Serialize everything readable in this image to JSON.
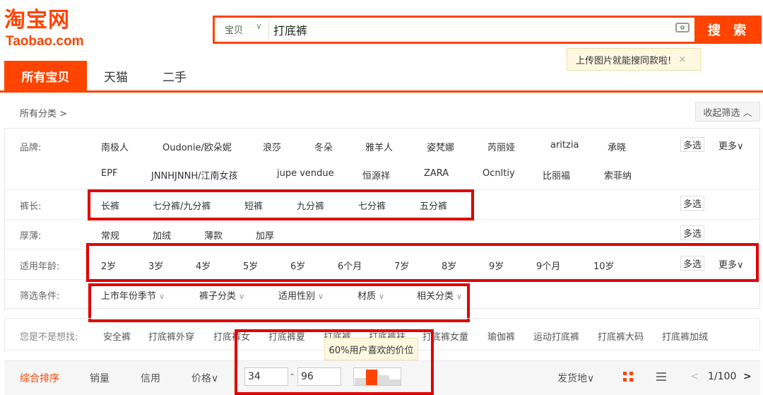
{
  "logo": {
    "cn": "淘宝网",
    "en": "Taobao.com"
  },
  "search": {
    "category": "宝贝",
    "query": "打底裤",
    "button": "搜 索",
    "tooltip": "上传图片就能搜同款啦!",
    "tooltip_close": "×"
  },
  "tabs": [
    "所有宝贝",
    "天猫",
    "二手"
  ],
  "category_bar": {
    "label": "所有分类 >",
    "collapse": "收起筛选 ︿"
  },
  "filters": {
    "brand": {
      "label": "品牌:",
      "row1": [
        "南极人",
        "Oudonie/欧朵妮",
        "浪莎",
        "冬朵",
        "雅羊人",
        "姿梵娜",
        "芮丽娅",
        "aritzia",
        "承晓"
      ],
      "row2": [
        "EPF",
        "JNNHJNNH/江南女孩",
        "jupe vendue",
        "恒源祥",
        "ZARA",
        "Ocnltiy",
        "比丽福",
        "索菲纳"
      ],
      "multi": "多选",
      "more": "更多∨"
    },
    "length": {
      "label": "裤长:",
      "options": [
        "长裤",
        "七分裤/九分裤",
        "短裤",
        "九分裤",
        "七分裤",
        "五分裤"
      ],
      "multi": "多选"
    },
    "thickness": {
      "label": "厚薄:",
      "options": [
        "常规",
        "加绒",
        "薄款",
        "加厚"
      ],
      "multi": "多选"
    },
    "age": {
      "label": "适用年龄:",
      "options": [
        "2岁",
        "3岁",
        "4岁",
        "5岁",
        "6岁",
        "6个月",
        "7岁",
        "8岁",
        "9岁",
        "9个月",
        "10岁"
      ],
      "multi": "多选",
      "more": "更多∨"
    },
    "conditions": {
      "label": "筛选条件:",
      "options": [
        "上市年份季节",
        "裤子分类",
        "适用性别",
        "材质",
        "相关分类"
      ],
      "chevron": "∨"
    }
  },
  "suggestions": {
    "label": "您是不是想找:",
    "items": [
      "安全裤",
      "打底裤外穿",
      "打底裤女",
      "打底裤夏",
      "打底裤",
      "打底裤袜",
      "打底裤女童",
      "瑜伽裤",
      "运动打底裤",
      "打底裤大码",
      "打底裤加绒"
    ]
  },
  "sort": {
    "items": [
      "综合排序",
      "销量",
      "信用",
      "价格∨"
    ],
    "price_min": "34",
    "price_max": "96",
    "price_sep": "-",
    "price_tip": "60%用户喜欢的价位",
    "ship_from": "发货地∨",
    "page": "1/100",
    "prev": "<",
    "next": ">"
  },
  "colors": {
    "accent": "#ff4400",
    "highlight_box": "#e00000"
  }
}
